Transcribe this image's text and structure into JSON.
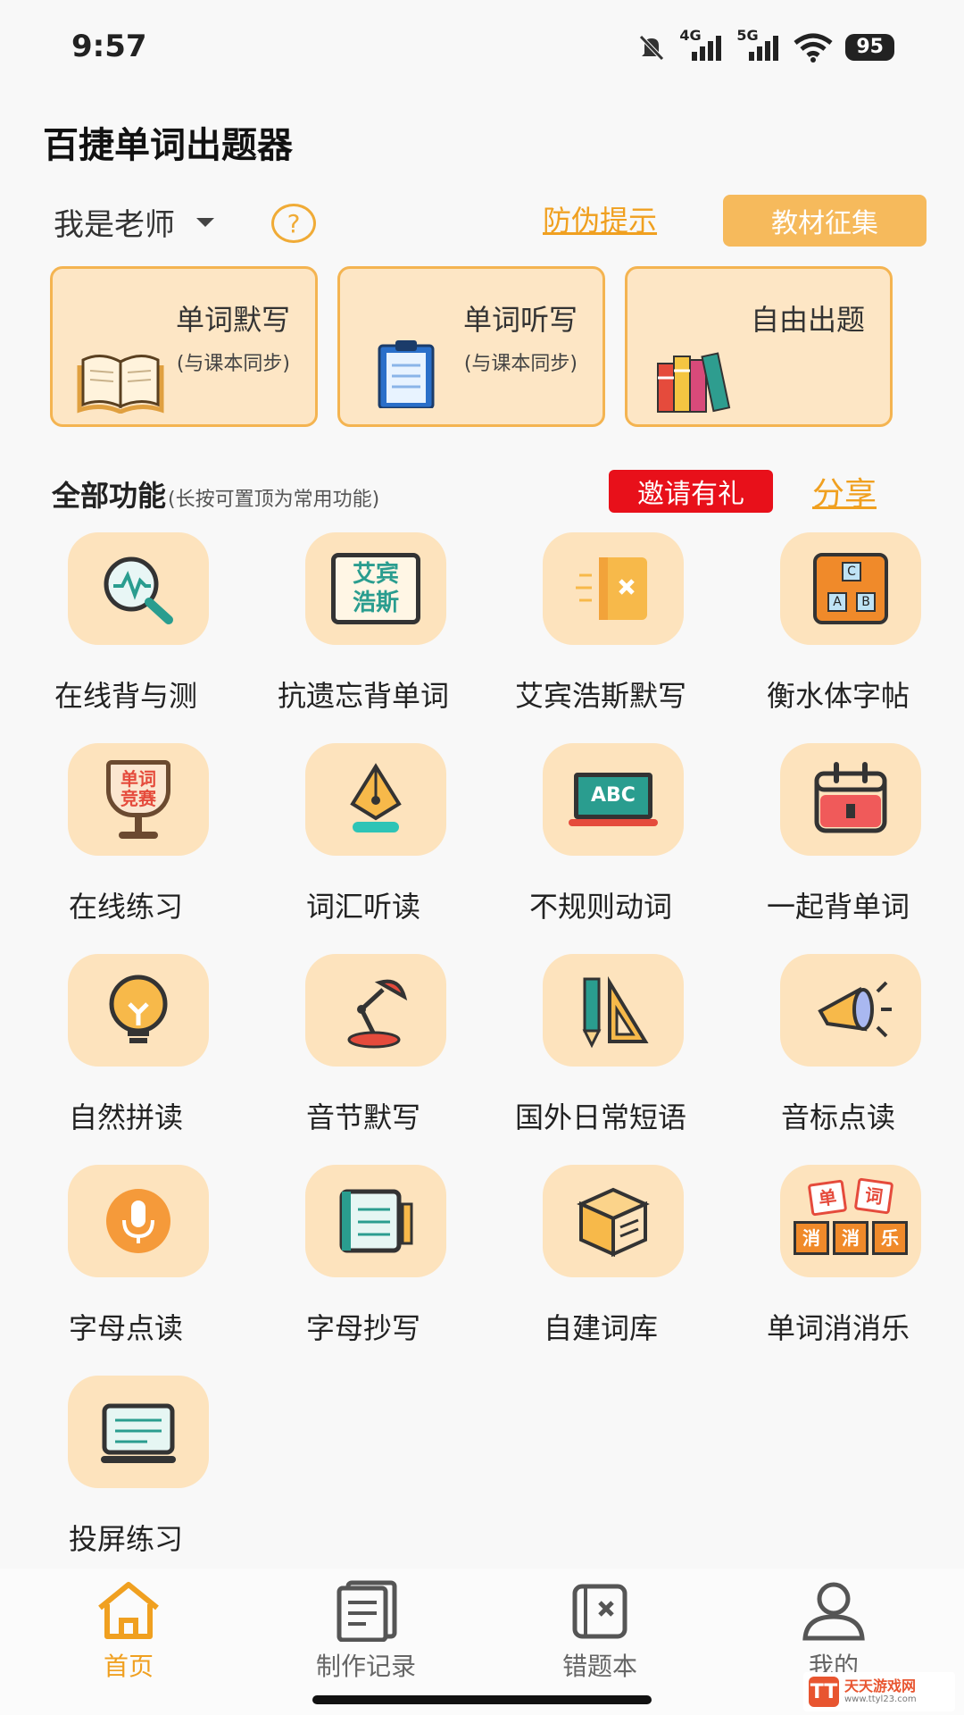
{
  "status_bar": {
    "time": "9:57",
    "network_4g": "4G",
    "network_5g": "5G",
    "battery": "95"
  },
  "app_title": "百捷单词出题器",
  "header": {
    "role": "我是老师",
    "help": "?",
    "anti_fake": "防伪提示",
    "collect": "教材征集"
  },
  "cards": [
    {
      "title": "单词默写",
      "subtitle": "(与课本同步)",
      "icon": "open-book-icon"
    },
    {
      "title": "单词听写",
      "subtitle": "(与课本同步)",
      "icon": "clipboard-icon"
    },
    {
      "title": "自由出题",
      "subtitle": "",
      "icon": "books-icon"
    }
  ],
  "section": {
    "title": "全部功能",
    "note": "(长按可置顶为常用功能)",
    "invite": "邀请有礼",
    "share": "分享"
  },
  "features": [
    {
      "label": "在线背与测",
      "icon": "magnifier-wave-icon"
    },
    {
      "label": "抗遗忘背单词",
      "icon": "word-board-icon",
      "glyphs": [
        "艾宾",
        "浩斯"
      ]
    },
    {
      "label": "艾宾浩斯默写",
      "icon": "notebook-x-icon"
    },
    {
      "label": "衡水体字帖",
      "icon": "abc-blocks-icon",
      "glyphs": [
        "C",
        "A",
        "B"
      ]
    },
    {
      "label": "在线练习",
      "icon": "trophy-icon",
      "glyphs": [
        "单词",
        "竞赛"
      ]
    },
    {
      "label": "词汇听读",
      "icon": "pen-nib-icon"
    },
    {
      "label": "不规则动词",
      "icon": "chalkboard-icon",
      "glyphs": [
        "ABC"
      ]
    },
    {
      "label": "一起背单词",
      "icon": "calendar-icon"
    },
    {
      "label": "自然拼读",
      "icon": "lightbulb-icon"
    },
    {
      "label": "音节默写",
      "icon": "desk-lamp-icon"
    },
    {
      "label": "国外日常短语",
      "icon": "ruler-pencil-icon"
    },
    {
      "label": "音标点读",
      "icon": "megaphone-icon"
    },
    {
      "label": "字母点读",
      "icon": "microphone-icon"
    },
    {
      "label": "字母抄写",
      "icon": "copybook-icon"
    },
    {
      "label": "自建词库",
      "icon": "box-icon"
    },
    {
      "label": "单词消消乐",
      "icon": "word-match-icon",
      "glyphs": [
        "单",
        "词",
        "消",
        "消",
        "乐"
      ]
    },
    {
      "label": "投屏练习",
      "icon": "screen-icon"
    }
  ],
  "bottom_nav": [
    {
      "label": "首页",
      "icon": "home-icon",
      "active": true
    },
    {
      "label": "制作记录",
      "icon": "records-icon",
      "active": false
    },
    {
      "label": "错题本",
      "icon": "error-book-icon",
      "active": false
    },
    {
      "label": "我的",
      "icon": "profile-icon",
      "active": false
    }
  ],
  "watermark": {
    "logo": "TT",
    "name": "天天游戏网",
    "url": "www.ttyl23.com"
  },
  "colors": {
    "accent": "#f0a020",
    "tile_bg": "#fde3bd",
    "card_bg": "#fde6c5",
    "invite_red": "#e8101a"
  }
}
